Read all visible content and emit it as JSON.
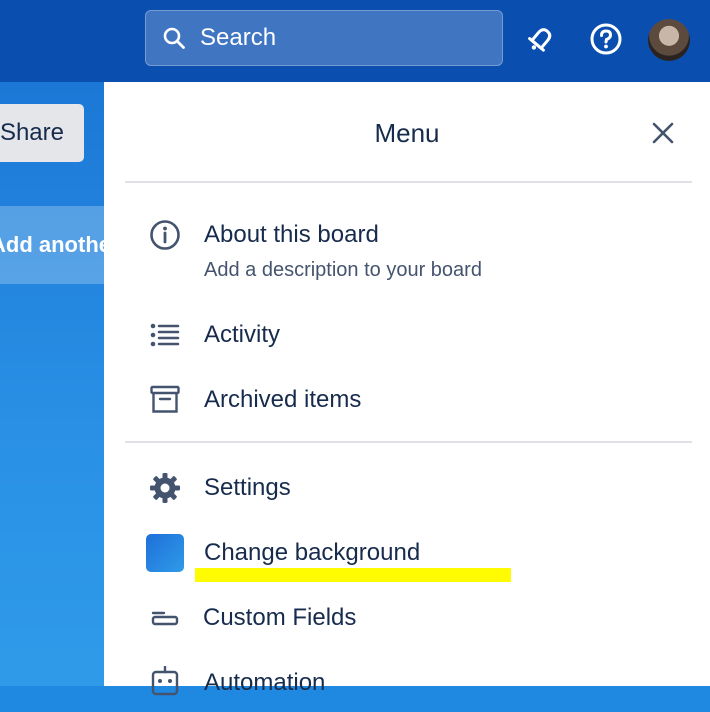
{
  "header": {
    "search_label": "Search"
  },
  "board": {
    "share_label": "Share",
    "add_list_label": "Add another list"
  },
  "menu": {
    "title": "Menu",
    "items": [
      {
        "label": "About this board",
        "sub": "Add a description to your board",
        "icon": "info-icon"
      },
      {
        "label": "Activity",
        "icon": "activity-list-icon"
      },
      {
        "label": "Archived items",
        "icon": "archive-icon"
      },
      {
        "label": "Settings",
        "icon": "gear-icon"
      },
      {
        "label": "Change background",
        "icon": "background-swatch"
      },
      {
        "label": "Custom Fields",
        "icon": "custom-fields-icon"
      },
      {
        "label": "Automation",
        "icon": "automation-icon"
      }
    ]
  },
  "colors": {
    "header": "#0a4fb0",
    "board": "#1f88e0",
    "highlight": "#fffb00",
    "text": "#172b4d"
  }
}
